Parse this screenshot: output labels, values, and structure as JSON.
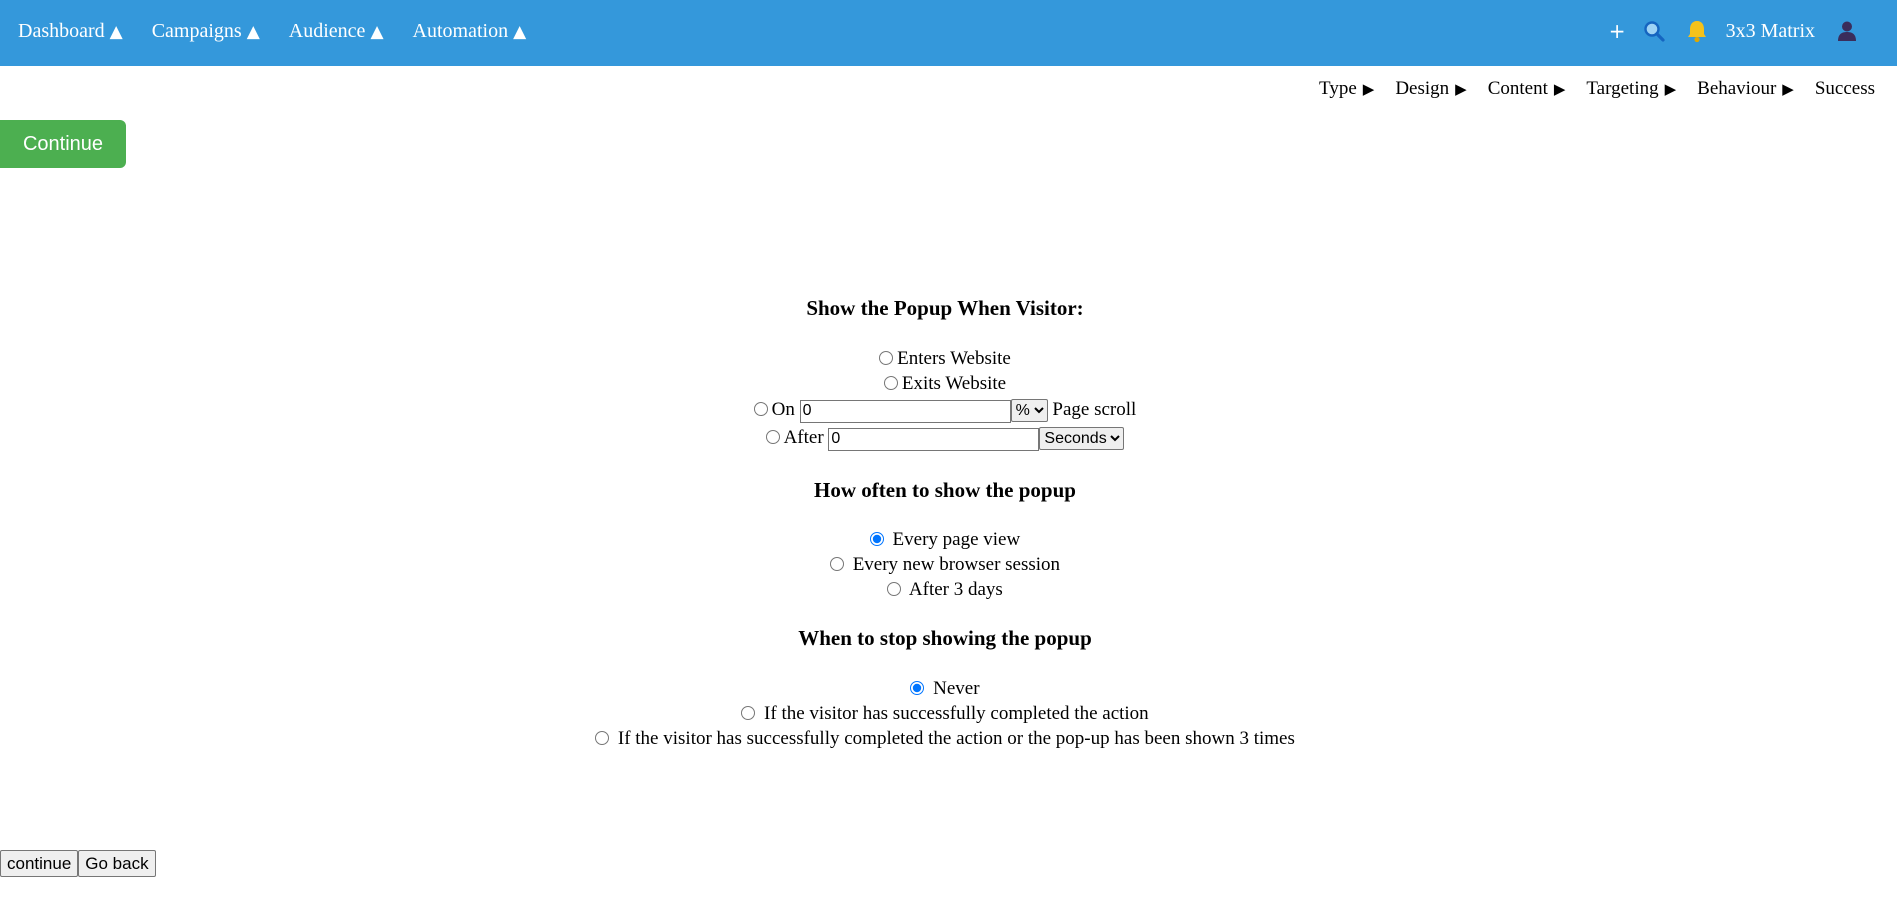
{
  "nav": {
    "items": [
      {
        "label": "Dashboard",
        "arrow": "▲"
      },
      {
        "label": "Campaigns",
        "arrow": "▲"
      },
      {
        "label": "Audience",
        "arrow": "▲"
      },
      {
        "label": "Automation",
        "arrow": "▲"
      }
    ],
    "plus": "+",
    "account": "3x3 Matrix",
    "icons": {
      "search": "search-icon",
      "bell": "bell-icon",
      "user": "user-icon"
    },
    "colors": {
      "bar": "#3498db",
      "bell": "#f4c21b",
      "user": "#3a2d5c"
    }
  },
  "steps": [
    {
      "label": "Type",
      "arrow": "▶"
    },
    {
      "label": "Design",
      "arrow": "▶"
    },
    {
      "label": "Content",
      "arrow": "▶"
    },
    {
      "label": "Targeting",
      "arrow": "▶"
    },
    {
      "label": "Behaviour",
      "arrow": "▶"
    },
    {
      "label": "Success",
      "arrow": ""
    }
  ],
  "continue_top": {
    "label": "Continue",
    "color": "#4caf50"
  },
  "show_when": {
    "heading": "Show the Popup When Visitor:",
    "enters": "Enters Website",
    "exits": "Exits Website",
    "on_label": "On",
    "on_value": "0",
    "on_unit": "%",
    "on_suffix": "Page scroll",
    "after_label": "After",
    "after_value": "0",
    "after_unit": "Seconds"
  },
  "how_often": {
    "heading": "How often to show the popup",
    "options": [
      "Every page view",
      "Every new browser session",
      "After 3 days"
    ],
    "selected": "Every page view"
  },
  "stop_showing": {
    "heading": "When to stop showing the popup",
    "options": [
      "Never",
      "If the visitor has successfully completed the action",
      "If the visitor has successfully completed the action or the pop-up has been shown 3 times"
    ],
    "selected": "Never"
  },
  "bottom": {
    "continue": "continue",
    "go_back": "Go back"
  }
}
